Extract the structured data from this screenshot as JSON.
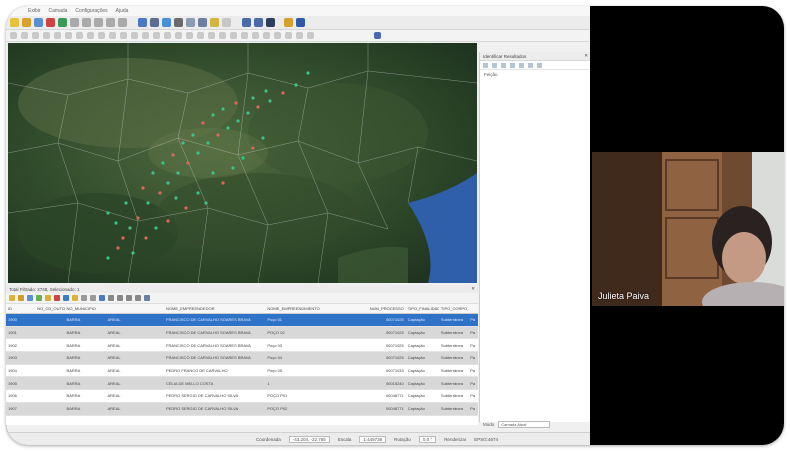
{
  "menu": {
    "items": [
      "Exibir",
      "Camada",
      "Configurações",
      "Ajuda"
    ]
  },
  "identify_panel": {
    "title": "Identificar Resultados",
    "field_label": "Feição",
    "mode_label": "Modo",
    "mode_value": "Camada Atual"
  },
  "attribute_table": {
    "title": "Total Filtrado: 2748, Selecionado: 1",
    "columns": [
      "ID",
      "NO_CD_OUTORGA",
      "NO_MUNICIPIO",
      "",
      "NOME_EMPREENDEDOR",
      "NOME_EMPREENDIMENTO",
      "NUM_PROCESSO",
      "TIPO_FINALIDADE",
      "TIPO_CORPO_HIDRICO",
      ""
    ],
    "rows": [
      [
        "1900",
        "",
        "BARRA",
        "AREAL",
        "FRANCISCO DE CARVALHO SOARES BRAVA",
        "Poço 01",
        "00071025",
        "Captação",
        "Subterrânea",
        "Pa"
      ],
      [
        "1901",
        "",
        "BARRA",
        "AREAL",
        "FRANCISCO DE CARVALHO SOARES BRAVA",
        "POÇO 02",
        "00071025",
        "Captação",
        "Subterrânea",
        "Pa"
      ],
      [
        "1902",
        "",
        "BARRA",
        "AREAL",
        "FRANCISCO DE CARVALHO SOARES BRAVA",
        "Poço 03",
        "00071025",
        "Captação",
        "Subterrânea",
        "Pa"
      ],
      [
        "1903",
        "",
        "BARRA",
        "AREAL",
        "FRANCISCO DE CARVALHO SOARES BRAVA",
        "Poço 04",
        "00071025",
        "Captação",
        "Subterrânea",
        "Pa"
      ],
      [
        "1904",
        "",
        "BARRA",
        "AREAL",
        "PEDRO FRANCO DE CARVALHO",
        "Poço 05",
        "00071033",
        "Captação",
        "Subterrânea",
        "Pa"
      ],
      [
        "1905",
        "",
        "BARRA",
        "AREAL",
        "CÉLIA DE MELLO COSTA",
        "1",
        "00015240",
        "Captação",
        "Subterrânea",
        "Pa"
      ],
      [
        "1906",
        "",
        "BARRA",
        "AREAL",
        "PEDRO SERGIO DE CARVALHO SILVA",
        "POÇO P01",
        "00048771",
        "Captação",
        "Subterrânea",
        "Pa"
      ],
      [
        "1907",
        "",
        "BARRA",
        "AREAL",
        "PEDRO SERGIO DE CARVALHO SILVA",
        "POÇO P02",
        "00048771",
        "Captação",
        "Subterrânea",
        "Pa"
      ]
    ]
  },
  "status_bar": {
    "coordinate_label": "Coordenada",
    "coordinate_value": "-43.204, -22.765",
    "scale_label": "Escala",
    "scale_value": "1:449738",
    "rotation_label": "Rotação",
    "rotation_value": "0,0 °",
    "render_label": "Renderizar",
    "crs": "EPSG:4674"
  },
  "video": {
    "participant_name": "Julieta Paiva"
  },
  "colors": {
    "selection": "#2f73c9",
    "point_green": "#3cc28a",
    "point_red": "#e0665a",
    "water": "#2f5fa8"
  }
}
